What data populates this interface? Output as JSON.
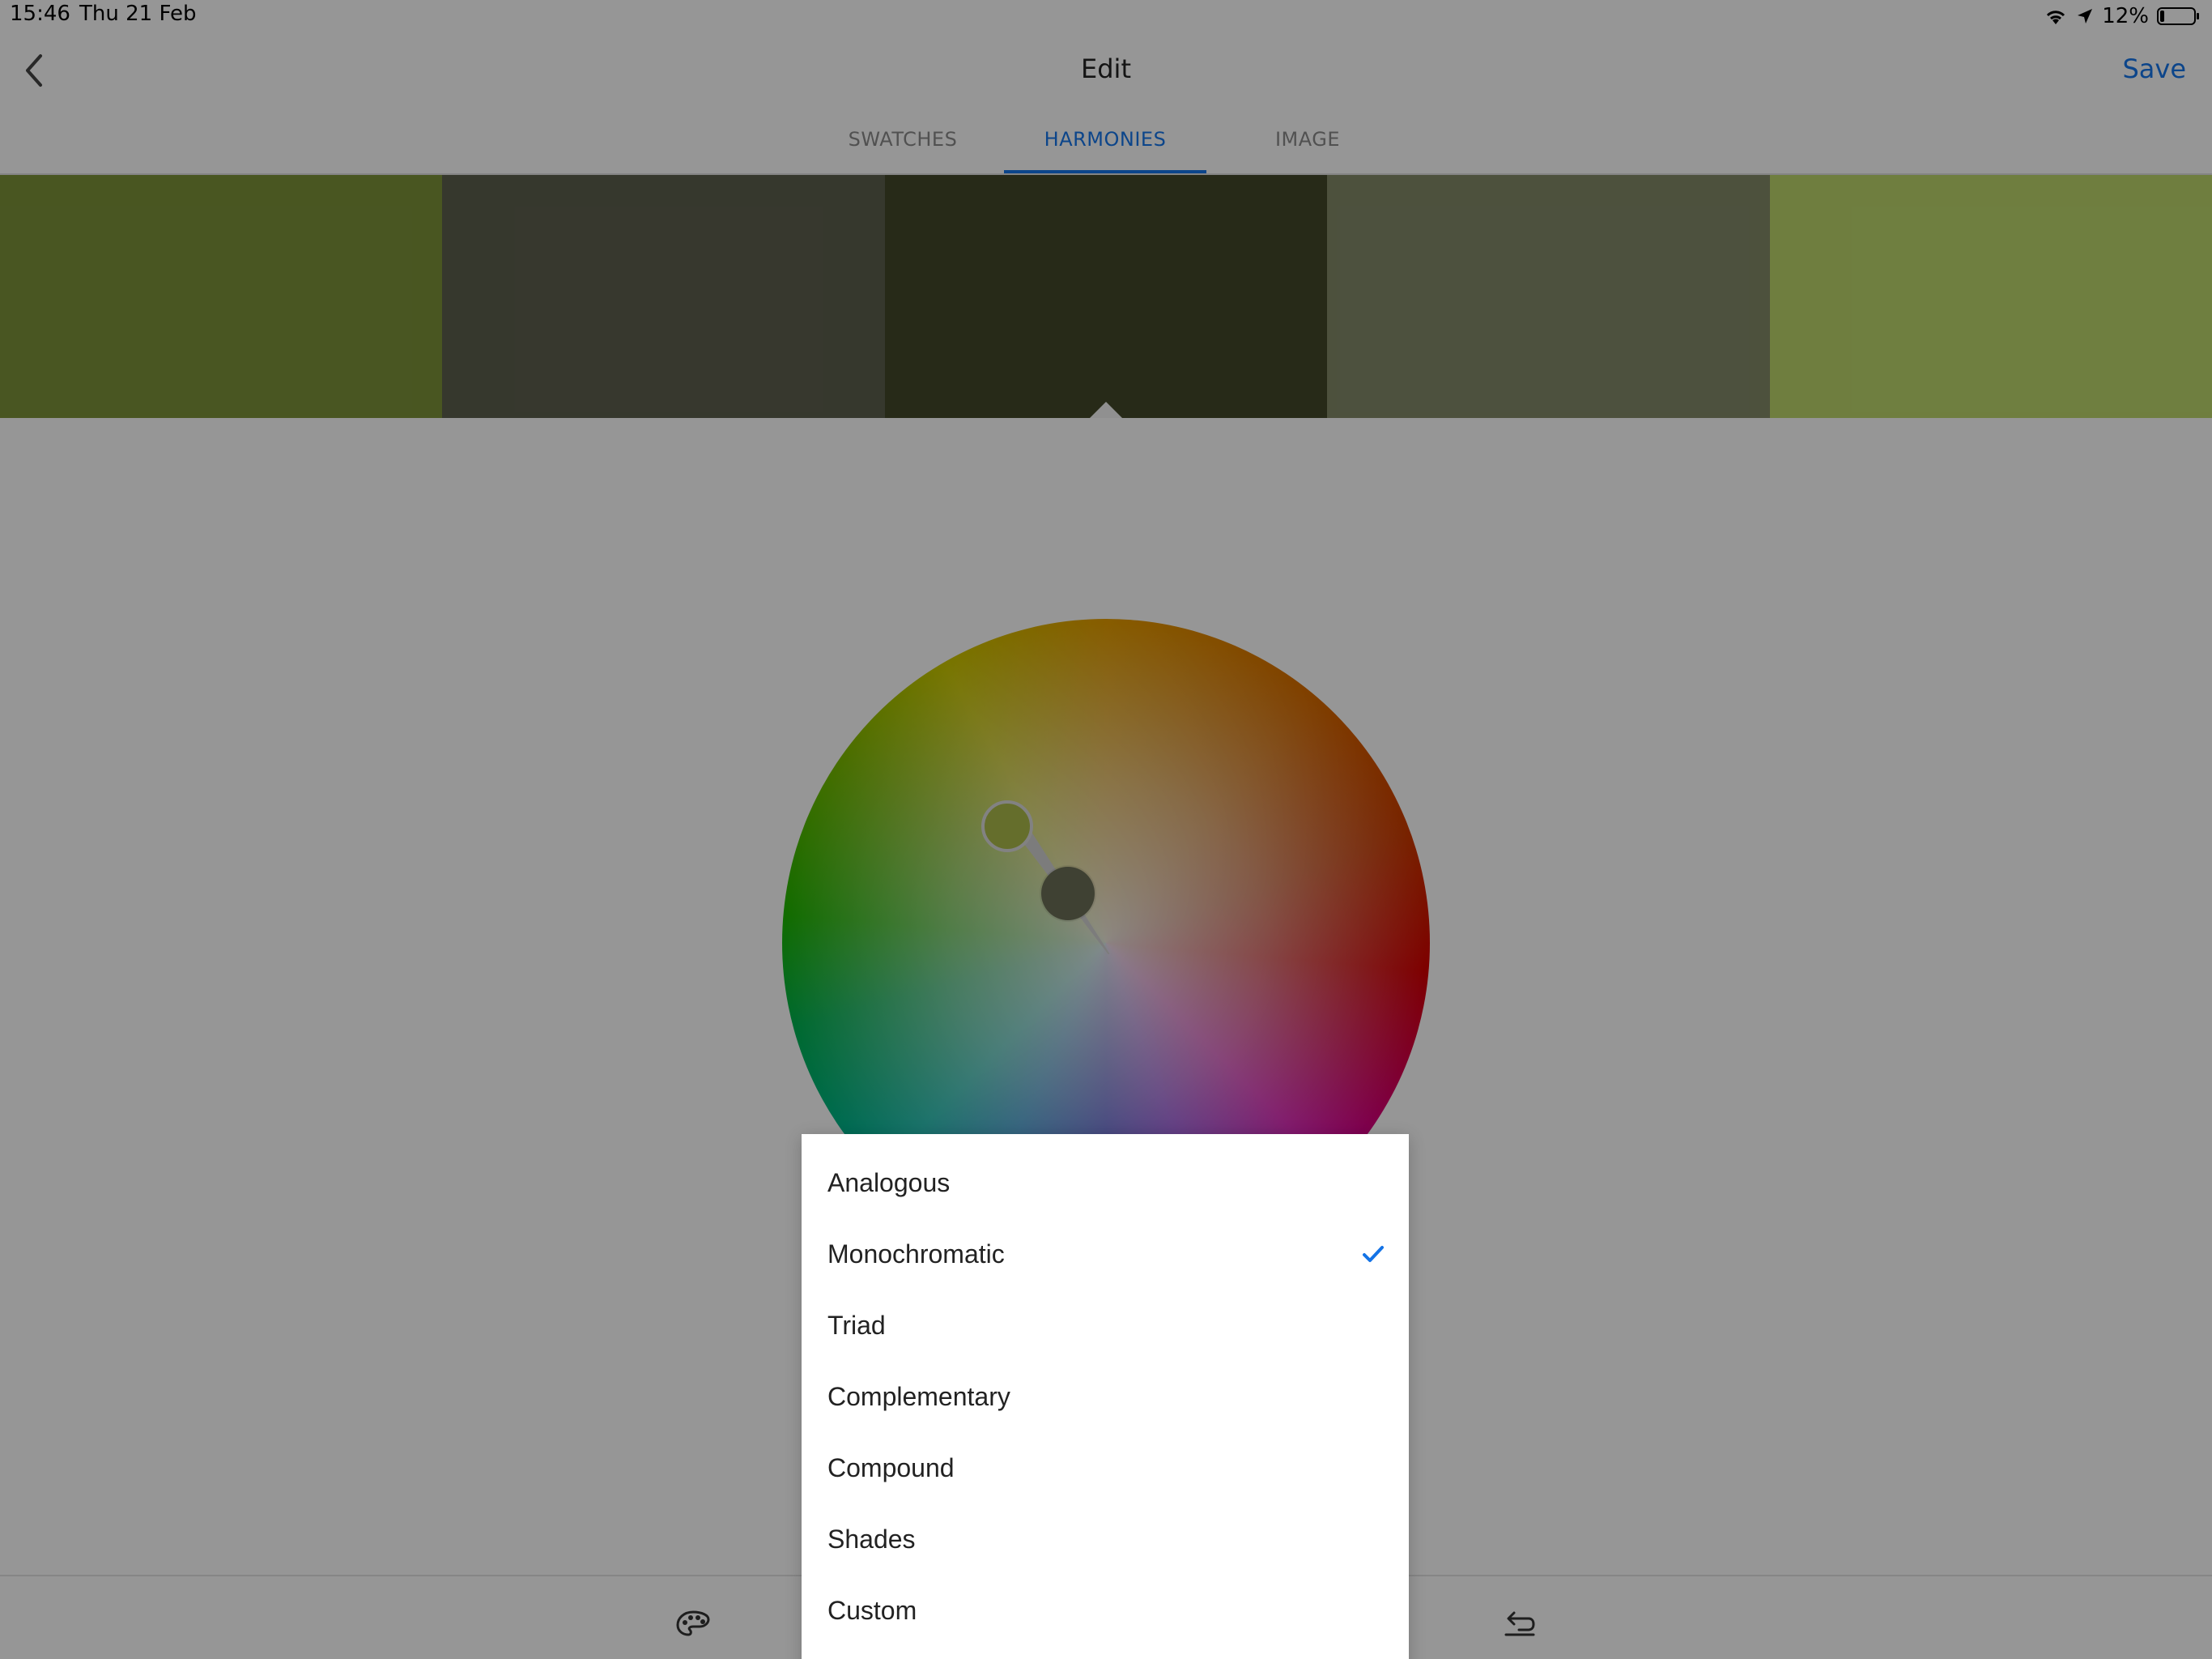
{
  "status": {
    "time": "15:46",
    "date": "Thu 21 Feb",
    "battery": "12%"
  },
  "nav": {
    "title": "Edit",
    "save": "Save"
  },
  "tabs": [
    {
      "label": "SWATCHES",
      "active": false
    },
    {
      "label": "HARMONIES",
      "active": true
    },
    {
      "label": "IMAGE",
      "active": false
    }
  ],
  "swatches": [
    "#7a9038",
    "#5b5e4c",
    "#414628",
    "#818767",
    "#b9d36a"
  ],
  "selected_swatch_index": 2,
  "wheel": {
    "handle_color": "#a8b84a",
    "base_color": "#6a6d56"
  },
  "dropdown": {
    "options": [
      {
        "label": "Analogous",
        "selected": false
      },
      {
        "label": "Monochromatic",
        "selected": true
      },
      {
        "label": "Triad",
        "selected": false
      },
      {
        "label": "Complementary",
        "selected": false
      },
      {
        "label": "Compound",
        "selected": false
      },
      {
        "label": "Shades",
        "selected": false
      },
      {
        "label": "Custom",
        "selected": false
      }
    ]
  },
  "toolbar": {
    "left_icon": "palette-icon",
    "right_icon": "undo-icon"
  },
  "colors": {
    "accent": "#1473e6"
  }
}
